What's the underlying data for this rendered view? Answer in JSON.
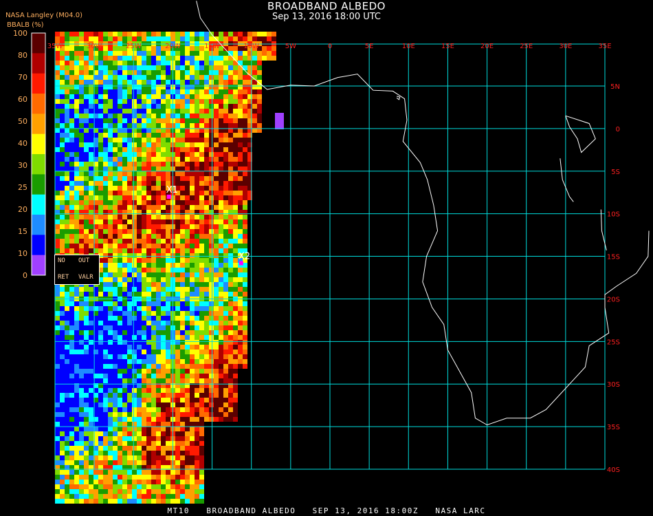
{
  "header": {
    "title": "BROADBAND ALBEDO",
    "subtitle": "Sep 13, 2016 18:00 UTC",
    "source": "NASA Langley (M04.0)"
  },
  "colorbar": {
    "title": "BBALB (%)",
    "ticks": [
      "100",
      "80",
      "70",
      "60",
      "50",
      "40",
      "30",
      "25",
      "20",
      "15",
      "10",
      "0"
    ],
    "colors": [
      "#5a0000",
      "#b00000",
      "#ff1a00",
      "#ff6a00",
      "#ffa000",
      "#ffff00",
      "#7fdc00",
      "#1a9c00",
      "#00ffff",
      "#1e8cff",
      "#0000ff",
      "#a040ff"
    ]
  },
  "legend": {
    "no": "NO",
    "out": "OUT",
    "ret": "RET",
    "valr": "VALR"
  },
  "map": {
    "lon_labels": [
      "35W",
      "30W",
      "25W",
      "20W",
      "15W",
      "10W",
      "5W",
      "0",
      "5E",
      "10E",
      "15E",
      "20E",
      "25E",
      "30E",
      "35E"
    ],
    "lat_labels": [
      "5N",
      "0",
      "5S",
      "10S",
      "15S",
      "20S",
      "25S",
      "30S",
      "35S",
      "40S"
    ],
    "markers": [
      {
        "label": "X1",
        "lon": -20.5,
        "lat": -8.0
      },
      {
        "label": "X2",
        "lon": -11.3,
        "lat": -15.8
      }
    ],
    "grid_color": "#00dede",
    "label_color": "#ff2020",
    "coast_color": "#ffffff"
  },
  "footer": "MT10   BROADBAND ALBEDO   SEP 13, 2016 18:00Z   NASA LARC"
}
